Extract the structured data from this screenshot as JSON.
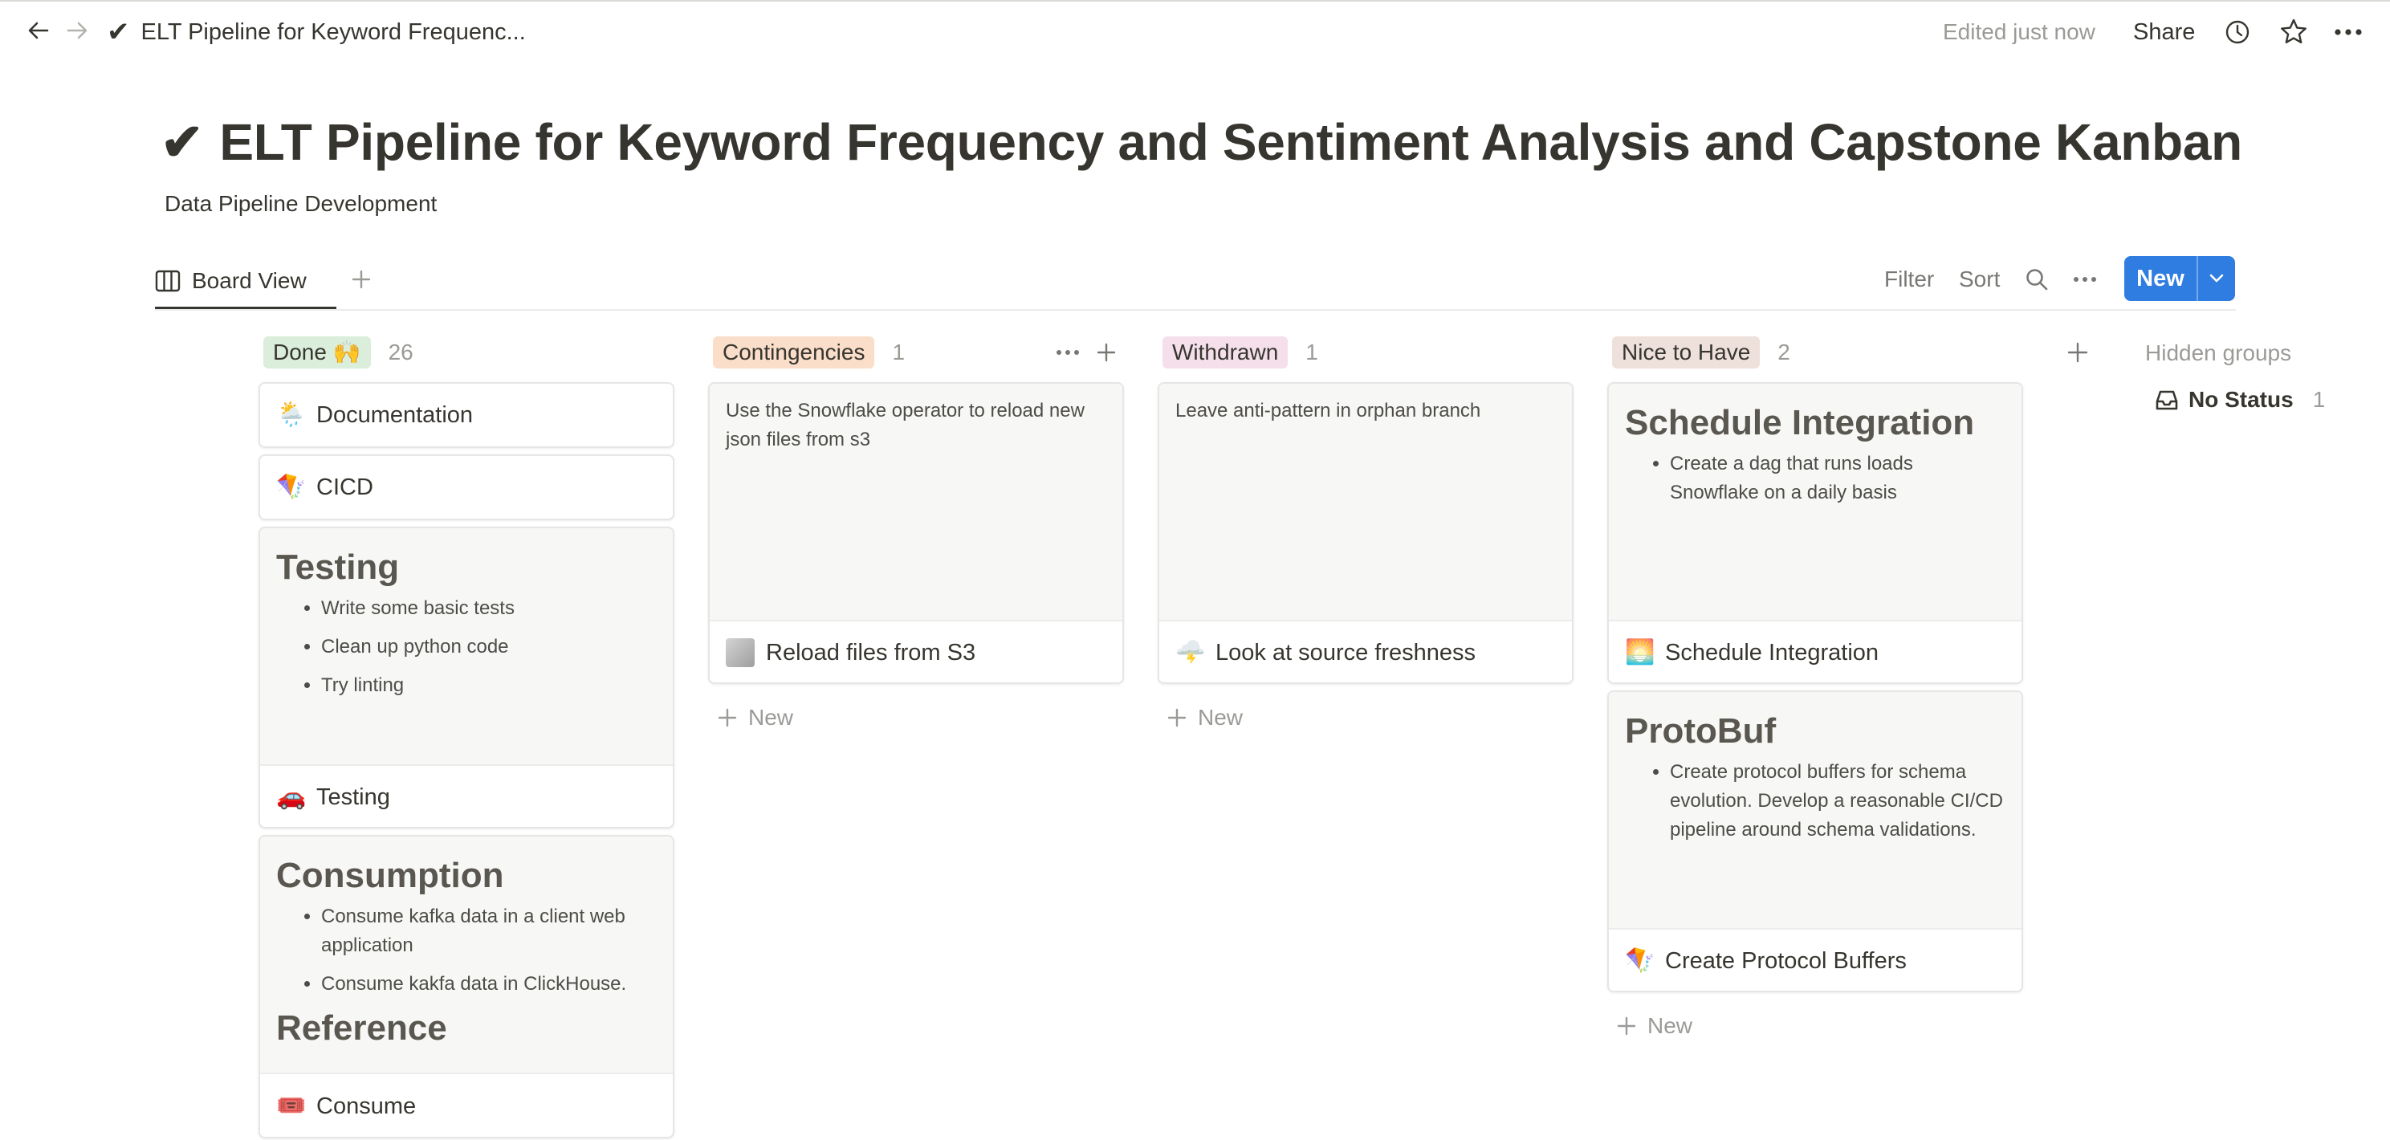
{
  "topbar": {
    "breadcrumb_icon": "✔",
    "breadcrumb_title": "ELT Pipeline for Keyword Frequenc...",
    "edited_label": "Edited just now",
    "share_label": "Share"
  },
  "page": {
    "title_icon": "✔",
    "title": "ELT Pipeline for Keyword Frequency and Sentiment Analysis and Capstone Kanban",
    "subtitle": "Data Pipeline Development"
  },
  "view_bar": {
    "tab_label": "Board View",
    "filter_label": "Filter",
    "sort_label": "Sort",
    "new_label": "New"
  },
  "columns": [
    {
      "label": "Done 🙌",
      "count": "26",
      "color": "#dbeddb",
      "cards": [
        {
          "icon": "🌦️",
          "title": "Documentation"
        },
        {
          "icon": "🪁",
          "title": "CICD"
        },
        {
          "icon": "🚗",
          "title": "Testing",
          "preview_heading": "Testing",
          "preview_bullets": [
            "Write some basic tests",
            "Clean up python code",
            "Try linting"
          ]
        },
        {
          "icon": "🎟️",
          "title": "Consume",
          "preview_heading": "Consumption",
          "preview_bullets": [
            "Consume kafka data in a client web application",
            "Consume kakfa data in ClickHouse."
          ],
          "preview_heading2": "Reference"
        }
      ]
    },
    {
      "label": "Contingencies",
      "count": "1",
      "color": "#fadec9",
      "cards": [
        {
          "icon": "◻",
          "title": "Reload files from S3",
          "preview_text": "Use the Snowflake operator to reload new json files from s3"
        }
      ],
      "new_label": "New"
    },
    {
      "label": "Withdrawn",
      "count": "1",
      "color": "#f4dfeb",
      "cards": [
        {
          "icon": "🌩️",
          "title": "Look at source freshness",
          "preview_text": "Leave anti-pattern in orphan branch"
        }
      ],
      "new_label": "New"
    },
    {
      "label": "Nice to Have",
      "count": "2",
      "color": "#eee0da",
      "cards": [
        {
          "icon": "🌅",
          "title": "Schedule Integration",
          "preview_heading": "Schedule Integration",
          "preview_bullets": [
            "Create a dag that runs loads Snowflake on a daily basis"
          ]
        },
        {
          "icon": "🪁",
          "title": "Create Protocol Buffers",
          "preview_heading": "ProtoBuf",
          "preview_bullets": [
            "Create protocol buffers for schema evolution. Develop a reasonable CI/CD pipeline around schema validations."
          ]
        }
      ],
      "new_label": "New"
    }
  ],
  "hidden": {
    "label": "Hidden groups",
    "no_status_label": "No Status",
    "no_status_count": "1"
  },
  "accent_color": "#2f7de1"
}
